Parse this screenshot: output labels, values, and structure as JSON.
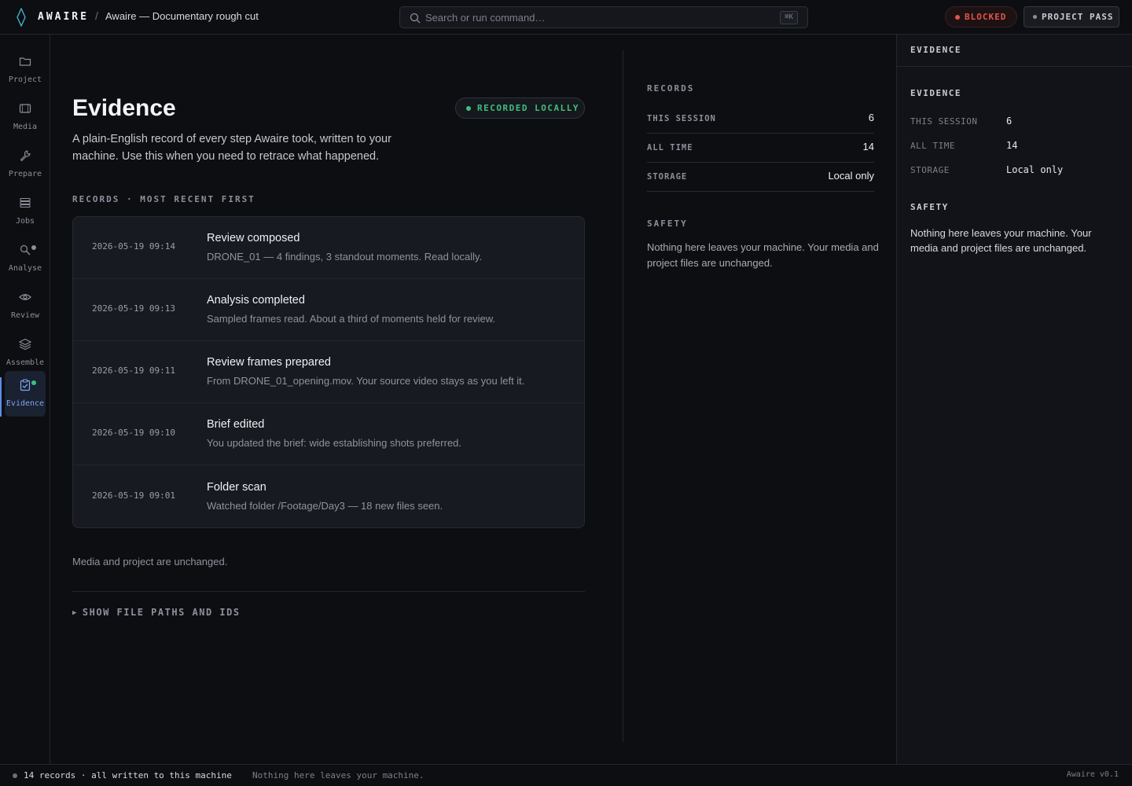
{
  "app": {
    "brand": "AWAIRE",
    "breadcrumb_sep": "/",
    "project_title": "Awaire — Documentary rough cut"
  },
  "search": {
    "placeholder": "Search or run command…",
    "shortcut": "⌘K"
  },
  "header_badges": {
    "blocked": "BLOCKED",
    "project_pass": "PROJECT PASS"
  },
  "nav": {
    "items": [
      {
        "label": "Project",
        "icon": "folder-icon"
      },
      {
        "label": "Media",
        "icon": "media-icon"
      },
      {
        "label": "Prepare",
        "icon": "wrench-icon"
      },
      {
        "label": "Jobs",
        "icon": "stack-icon"
      },
      {
        "label": "Analyse",
        "icon": "magnify-icon"
      },
      {
        "label": "Review",
        "icon": "eye-icon"
      },
      {
        "label": "Assemble",
        "icon": "layers-icon"
      },
      {
        "label": "Evidence",
        "icon": "clipboard-check-icon"
      }
    ],
    "active": "Evidence"
  },
  "main": {
    "title": "Evidence",
    "recorded_badge": "RECORDED LOCALLY",
    "lede": "A plain-English record of every step Awaire took, written to your machine. Use this when you need to retrace what happened.",
    "records_label": "RECORDS · MOST RECENT FIRST",
    "records": [
      {
        "time": "2026-05-19 09:14",
        "title": "Review composed",
        "desc": "DRONE_01 — 4 findings, 3 standout moments. Read locally."
      },
      {
        "time": "2026-05-19 09:13",
        "title": "Analysis completed",
        "desc": "Sampled frames read. About a third of moments held for review."
      },
      {
        "time": "2026-05-19 09:11",
        "title": "Review frames prepared",
        "desc": "From DRONE_01_opening.mov. Your source video stays as you left it."
      },
      {
        "time": "2026-05-19 09:10",
        "title": "Brief edited",
        "desc": "You updated the brief: wide establishing shots preferred."
      },
      {
        "time": "2026-05-19 09:01",
        "title": "Folder scan",
        "desc": "Watched folder /Footage/Day3 — 18 new files seen."
      }
    ],
    "unchanged_note": "Media and project are unchanged.",
    "disclosure": "SHOW FILE PATHS AND IDS"
  },
  "summary": {
    "records_heading": "RECORDS",
    "rows": [
      {
        "key": "THIS SESSION",
        "value": "6"
      },
      {
        "key": "ALL TIME",
        "value": "14"
      },
      {
        "key": "STORAGE",
        "value": "Local only"
      }
    ],
    "safety_heading": "SAFETY",
    "safety_text": "Nothing here leaves your machine. Your media and project files are unchanged."
  },
  "right_panel": {
    "header": "EVIDENCE",
    "section_heading": "EVIDENCE",
    "rows": [
      {
        "key": "THIS SESSION",
        "value": "6"
      },
      {
        "key": "ALL TIME",
        "value": "14"
      },
      {
        "key": "STORAGE",
        "value": "Local only"
      }
    ],
    "safety_heading": "SAFETY",
    "safety_text": "Nothing here leaves your machine. Your media and project files are unchanged."
  },
  "statusbar": {
    "left": "14 records · all written to this machine",
    "middle": "Nothing here leaves your machine.",
    "version": "Awaire v0.1"
  },
  "colors": {
    "accent": "#5b8def",
    "success": "#3fbf7f",
    "danger": "#e5534b",
    "background": "#0d0e12"
  }
}
